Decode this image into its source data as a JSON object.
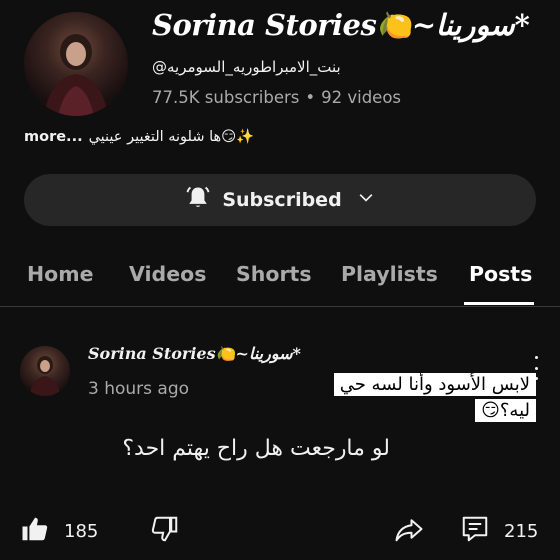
{
  "channel": {
    "title": "Sorina Stories🍋~سورينا*",
    "handle": "@بنت_الامبراطوريه_السومريه",
    "subscribers": "77.5K subscribers",
    "separator": "•",
    "videos": "92 videos",
    "description": "ها شلونه التغيير عينيي😏✨",
    "more": "more..."
  },
  "subscribe": {
    "label": "Subscribed"
  },
  "tabs": [
    {
      "label": "Home"
    },
    {
      "label": "Videos"
    },
    {
      "label": "Shorts"
    },
    {
      "label": "Playlists"
    },
    {
      "label": "Posts",
      "active": true
    }
  ],
  "post": {
    "author": "Sorina Stories🍋~سورينا*",
    "time": "3 hours ago",
    "caption_overlay": "لابس الأسود وأنا لسه حي ليه؟😏",
    "text": "لو مارجعت هل راح يهتم احد؟",
    "likes": "185",
    "comments": "215"
  },
  "icons": {
    "bell": "bell-icon",
    "chevron": "chevron-down-icon",
    "like": "thumbs-up-icon",
    "dislike": "thumbs-down-icon",
    "share": "share-icon",
    "comment": "comment-icon",
    "menu": "more-vert-icon"
  }
}
